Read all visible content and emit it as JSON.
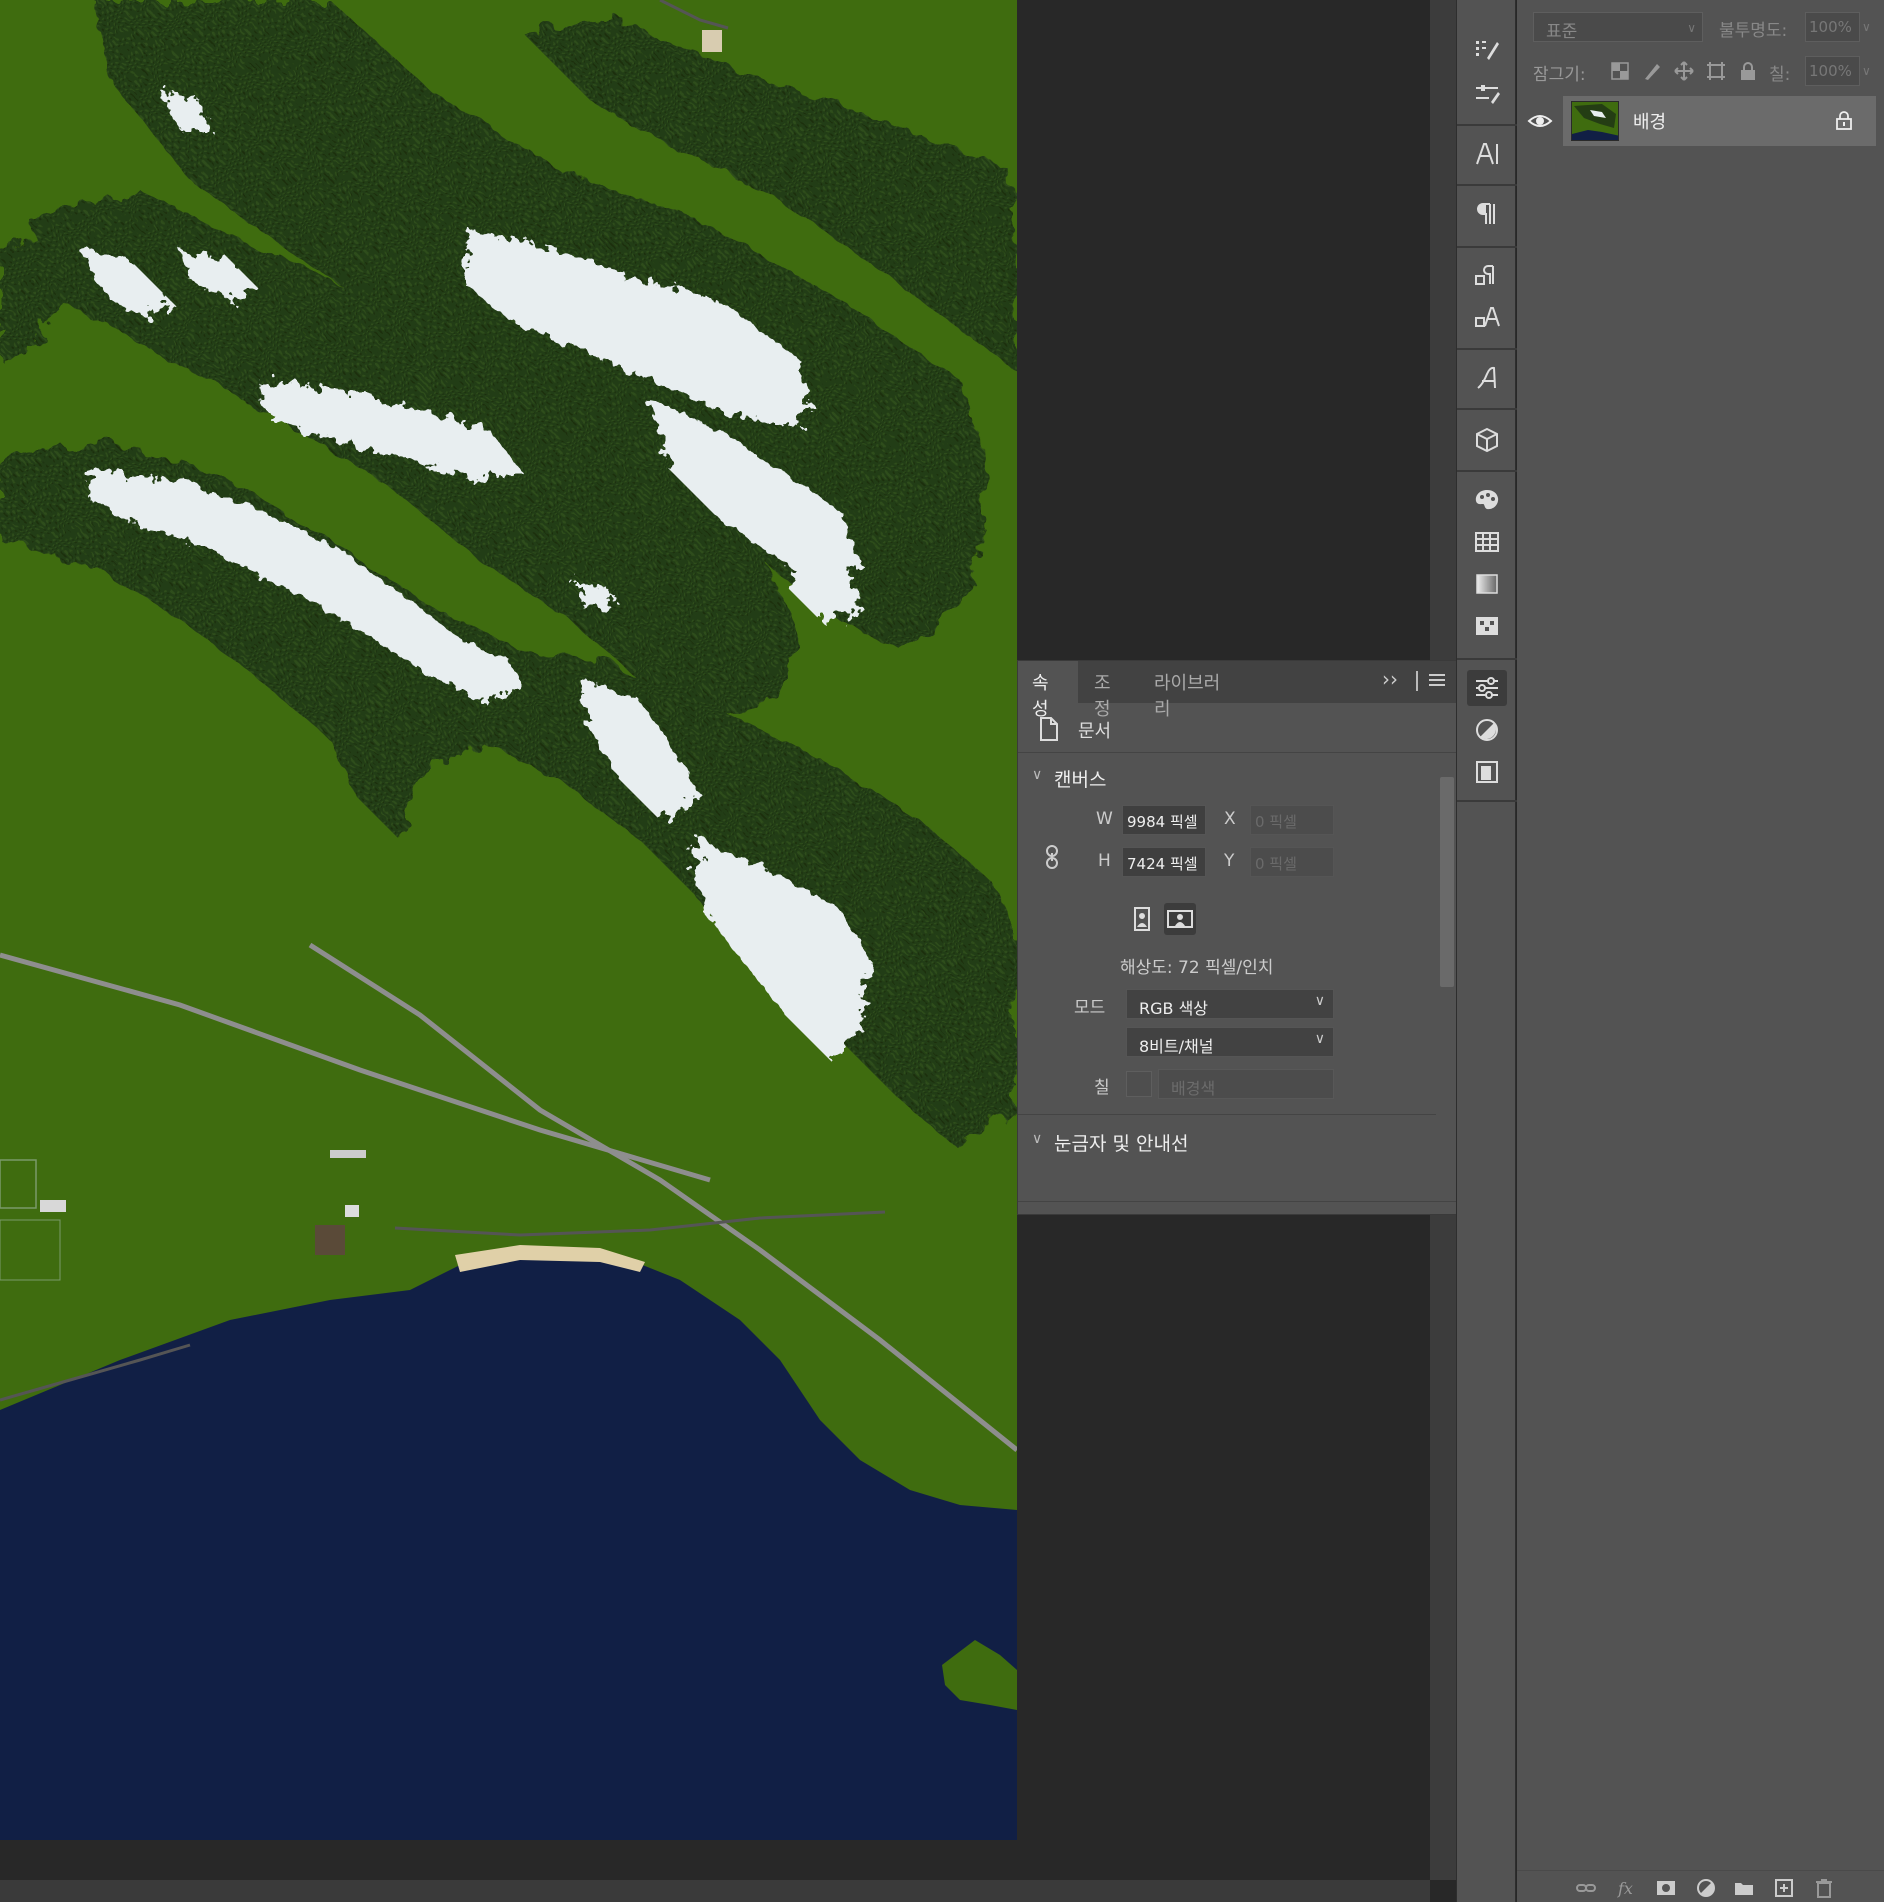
{
  "layers": {
    "blend_mode": "표준",
    "opacity_label": "불투명도:",
    "opacity_value": "100%",
    "lock_label": "잠그기:",
    "fill_label": "칠:",
    "fill_value": "100%",
    "items": [
      {
        "name": "배경",
        "visible": true,
        "locked": true
      }
    ],
    "bottom_icons": [
      "link-layers-icon",
      "fx-icon",
      "layer-mask-icon",
      "adjustment-layer-icon",
      "group-folder-icon",
      "new-layer-icon",
      "trash-icon"
    ]
  },
  "tool_strip": {
    "icons": [
      "brush-presets-icon",
      "brush-settings-icon",
      "character-icon",
      "paragraph-icon",
      "paragraph-styles-icon",
      "character-styles-icon",
      "glyphs-icon",
      "3d-icon",
      "color-palette-icon",
      "swatches-grid-icon",
      "gradient-icon",
      "patterns-icon",
      "properties-icon",
      "adjustments-icon",
      "libraries-icon"
    ],
    "active": "properties-icon"
  },
  "properties": {
    "tabs": [
      {
        "label": "속성",
        "active": true
      },
      {
        "label": "조정",
        "active": false
      },
      {
        "label": "라이브러리",
        "active": false
      }
    ],
    "expand_glyph": "››",
    "document_label": "문서",
    "canvas": {
      "title": "캔버스",
      "w_label": "W",
      "w_value": "9984 픽셀",
      "h_label": "H",
      "h_value": "7424 픽셀",
      "x_label": "X",
      "x_value": "0 픽셀",
      "y_label": "Y",
      "y_value": "0 픽셀",
      "resolution": "해상도: 72 픽셀/인치",
      "mode_label": "모드",
      "mode_value": "RGB 색상",
      "depth_value": "8비트/채널",
      "fill_label": "칠",
      "fill_value": "배경색"
    },
    "rulers_title": "눈금자 및 안내선"
  },
  "colors": {
    "grass": "#3f6c0f",
    "forest": "#243d14",
    "snow": "#e8eef0",
    "water": "#111f45",
    "beach": "#e0d0a8",
    "panel": "#535353",
    "workspace": "#282828"
  }
}
